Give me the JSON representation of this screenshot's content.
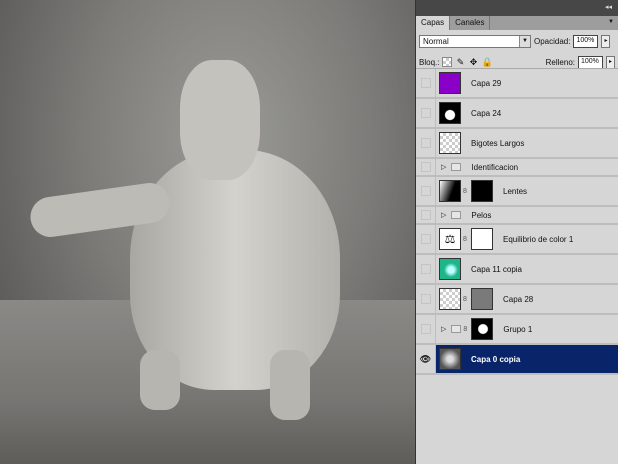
{
  "panel": {
    "tabs": [
      {
        "label": "Capas",
        "active": true
      },
      {
        "label": "Canales",
        "active": false
      }
    ],
    "blend_mode": "Normal",
    "opacity_label": "Opacidad:",
    "opacity": "100%",
    "lock_label": "Bloq.:",
    "fill_label": "Relleno:",
    "fill": "100%",
    "layers": [
      {
        "name": "Capa 29",
        "type": "layer",
        "thumb": "#8a00c8"
      },
      {
        "name": "Capa 24",
        "type": "layer"
      },
      {
        "name": "Bigotes Largos",
        "type": "layer"
      },
      {
        "name": "Identificacion",
        "type": "group"
      },
      {
        "name": "Lentes",
        "type": "layer-mask"
      },
      {
        "name": "Pelos",
        "type": "group"
      },
      {
        "name": "Equilibrio de color 1",
        "type": "adjustment"
      },
      {
        "name": "Capa 11 copia",
        "type": "layer",
        "thumb": "#1fb58a"
      },
      {
        "name": "Capa 28",
        "type": "layer-mask"
      },
      {
        "name": "Grupo 1",
        "type": "group-mask"
      },
      {
        "name": "Capa 0 copia",
        "type": "layer",
        "selected": true,
        "visible": true
      }
    ]
  },
  "colors": {
    "selection": "#0a246a",
    "panel": "#d6d6d6"
  }
}
